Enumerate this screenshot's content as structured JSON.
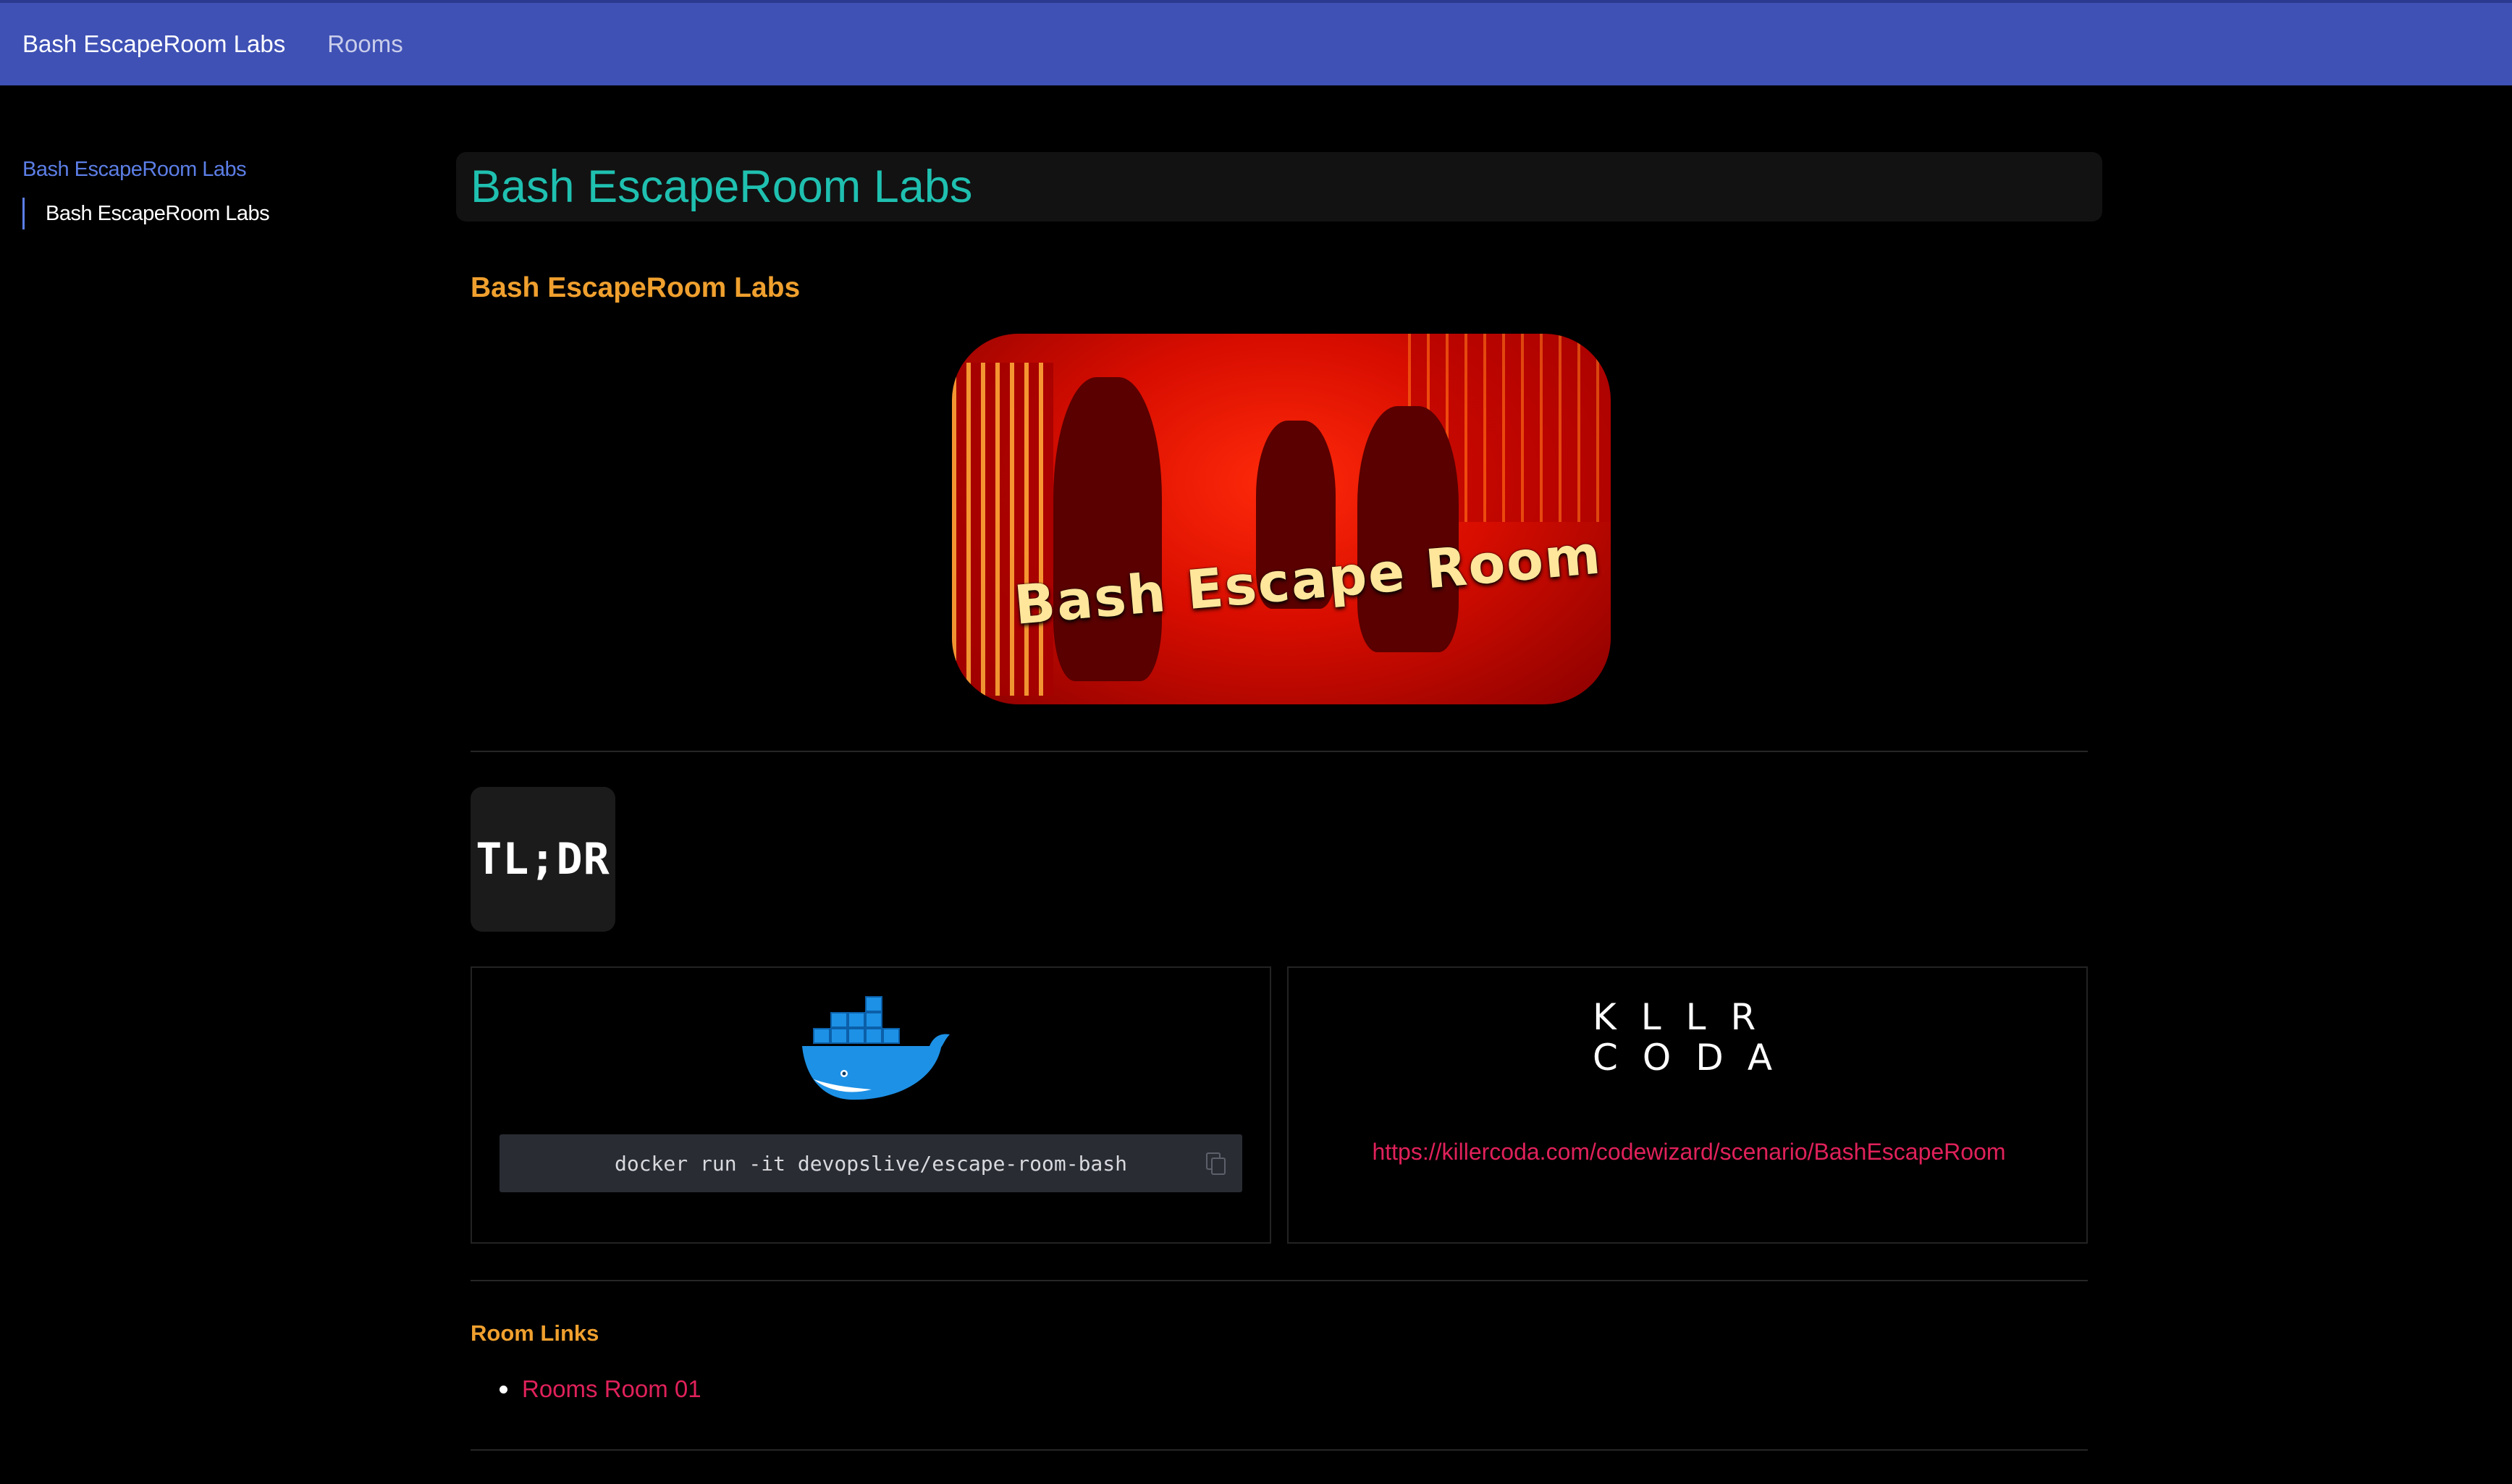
{
  "topbar": {
    "brand": "Bash EscapeRoom Labs",
    "nav_rooms": "Rooms",
    "bg_color": "#3f51b5"
  },
  "sidebar": {
    "section_title": "Bash EscapeRoom Labs",
    "items": [
      {
        "label": "Bash EscapeRoom Labs"
      }
    ]
  },
  "main": {
    "title": "Bash EscapeRoom Labs",
    "subtitle": "Bash EscapeRoom Labs",
    "hero": {
      "caption": "Bash Escape Room",
      "icon": "escape-room-banner-image"
    },
    "tldr_badge": "TL;DR",
    "docker_card": {
      "icon": "docker-whale-icon",
      "command": "docker run -it devopslive/escape-room-bash",
      "copy_icon": "copy-icon"
    },
    "killercoda_card": {
      "logo_row1": "KLLR",
      "logo_row2": "CODA",
      "link": "https://killercoda.com/codewizard/scenario/BashEscapeRoom"
    },
    "room_links": {
      "heading": "Room Links",
      "items": [
        {
          "label": "Rooms Room 01"
        }
      ]
    }
  },
  "colors": {
    "background": "#000000",
    "title": "#1fc0b0",
    "heading_accent": "#f0a02e",
    "link": "#e0215a",
    "sidebar_accent": "#5c7ee6"
  }
}
